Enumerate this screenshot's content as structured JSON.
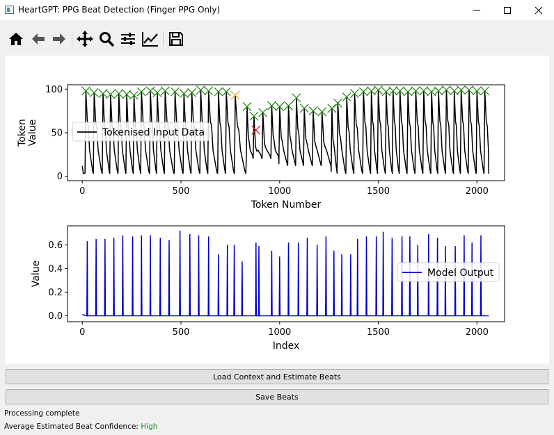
{
  "window": {
    "title": "HeartGPT: PPG Beat Detection (Finger PPG Only)",
    "icon": "app-window-icon"
  },
  "toolbar": {
    "buttons": [
      {
        "name": "home-icon",
        "tooltip": "Reset original view"
      },
      {
        "name": "back-arrow-icon",
        "tooltip": "Back"
      },
      {
        "name": "forward-arrow-icon",
        "tooltip": "Forward"
      },
      {
        "name": "pan-icon",
        "tooltip": "Pan"
      },
      {
        "name": "zoom-icon",
        "tooltip": "Zoom"
      },
      {
        "name": "subplots-icon",
        "tooltip": "Configure subplots"
      },
      {
        "name": "edit-axes-icon",
        "tooltip": "Edit axis"
      },
      {
        "name": "save-icon",
        "tooltip": "Save the figure"
      }
    ]
  },
  "chart_data": [
    {
      "type": "line",
      "xlabel": "Token Number",
      "ylabel": "Token Value",
      "xlim": [
        -75,
        2140
      ],
      "ylim": [
        -5,
        105
      ],
      "xticks": [
        0,
        500,
        1000,
        1500,
        2000
      ],
      "yticks": [
        0,
        50,
        100
      ],
      "legend": "center-left",
      "series": [
        {
          "name": "Tokenised Input Data",
          "color": "#000000",
          "beat_x": [
            18,
            60,
            105,
            143,
            185,
            225,
            262,
            300,
            345,
            380,
            420,
            470,
            515,
            555,
            600,
            640,
            690,
            730,
            775,
            835,
            870,
            915,
            960,
            1000,
            1045,
            1085,
            1125,
            1170,
            1215,
            1265,
            1295,
            1340,
            1380,
            1425,
            1465,
            1500,
            1540,
            1575,
            1610,
            1650,
            1690,
            1730,
            1770,
            1805,
            1845,
            1885,
            1920,
            1960,
            2000,
            2040
          ]
        }
      ],
      "markers": {
        "accepted": {
          "color": "#2a8a1a",
          "x": [
            18,
            60,
            105,
            143,
            185,
            225,
            262,
            300,
            345,
            380,
            420,
            470,
            515,
            555,
            600,
            640,
            690,
            730,
            835,
            870,
            915,
            960,
            1000,
            1045,
            1085,
            1125,
            1170,
            1215,
            1265,
            1295,
            1340,
            1380,
            1425,
            1465,
            1500,
            1540,
            1575,
            1610,
            1650,
            1690,
            1730,
            1770,
            1805,
            1845,
            1885,
            1920,
            1960,
            2000,
            2040
          ],
          "y": [
            98,
            96,
            95,
            94,
            95,
            94,
            93,
            97,
            98,
            96,
            98,
            97,
            95,
            96,
            99,
            98,
            97,
            97,
            80,
            69,
            73,
            81,
            80,
            81,
            90,
            78,
            75,
            74,
            78,
            84,
            91,
            95,
            97,
            98,
            99,
            97,
            98,
            98,
            97,
            98,
            98,
            97,
            98,
            99,
            98,
            99,
            99,
            98,
            98,
            99
          ]
        },
        "uncertain": {
          "color": "#ffa020",
          "x": [
            775
          ],
          "y": [
            93
          ]
        },
        "rejected": {
          "color": "#e02020",
          "x": [
            880
          ],
          "y": [
            53
          ]
        }
      }
    },
    {
      "type": "line",
      "xlabel": "Index",
      "ylabel": "Value",
      "xlim": [
        -75,
        2140
      ],
      "ylim": [
        -0.05,
        0.76
      ],
      "xticks": [
        0,
        500,
        1000,
        1500,
        2000
      ],
      "yticks": [
        0.0,
        0.2,
        0.4,
        0.6
      ],
      "legend": "center-right",
      "series": [
        {
          "name": "Model Output",
          "color": "#0000cc",
          "x": [
            25,
            70,
            115,
            160,
            205,
            255,
            300,
            345,
            395,
            440,
            495,
            545,
            590,
            640,
            690,
            735,
            770,
            810,
            880,
            895,
            960,
            1000,
            1045,
            1095,
            1140,
            1190,
            1235,
            1275,
            1315,
            1360,
            1395,
            1440,
            1490,
            1525,
            1570,
            1620,
            1660,
            1700,
            1755,
            1800,
            1840,
            1890,
            1935,
            1975,
            2020
          ],
          "y": [
            0.63,
            0.65,
            0.65,
            0.66,
            0.68,
            0.67,
            0.68,
            0.68,
            0.66,
            0.64,
            0.72,
            0.69,
            0.68,
            0.67,
            0.52,
            0.6,
            0.6,
            0.46,
            0.62,
            0.59,
            0.55,
            0.5,
            0.62,
            0.62,
            0.66,
            0.6,
            0.67,
            0.55,
            0.52,
            0.52,
            0.65,
            0.67,
            0.67,
            0.71,
            0.66,
            0.67,
            0.67,
            0.6,
            0.69,
            0.66,
            0.59,
            0.59,
            0.68,
            0.62,
            0.68
          ]
        }
      ]
    }
  ],
  "buttons": {
    "load_label": "Load Context and Estimate Beats",
    "save_label": "Save Beats"
  },
  "status": {
    "processing": "Processing complete",
    "confidence_label": "Average Estimated Beat Confidence: ",
    "confidence_value": "High",
    "confidence_color": "#1a8a1a"
  }
}
